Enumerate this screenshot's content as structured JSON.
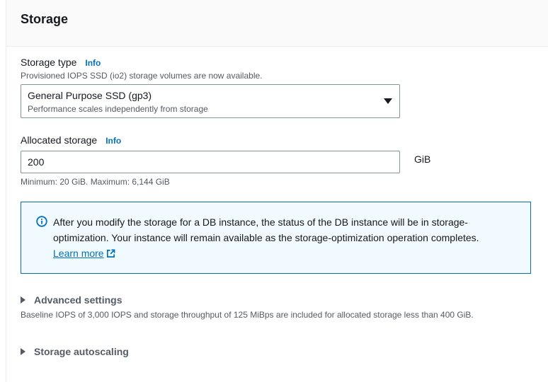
{
  "panel": {
    "title": "Storage"
  },
  "storage_type": {
    "label": "Storage type",
    "info": "Info",
    "description": "Provisioned IOPS SSD (io2) storage volumes are now available.",
    "selected": "General Purpose SSD (gp3)",
    "selected_description": "Performance scales independently from storage"
  },
  "allocated_storage": {
    "label": "Allocated storage",
    "info": "Info",
    "value": "200",
    "unit": "GiB",
    "constraint": "Minimum: 20 GiB. Maximum: 6,144 GiB"
  },
  "alert": {
    "text": "After you modify the storage for a DB instance, the status of the DB instance will be in storage-optimization. Your instance will remain available as the storage-optimization operation completes.",
    "link": "Learn more"
  },
  "advanced": {
    "label": "Advanced settings",
    "description": "Baseline IOPS of 3,000 IOPS and storage throughput of 125 MiBps are included for allocated storage less than 400 GiB."
  },
  "autoscaling": {
    "label": "Storage autoscaling"
  },
  "colors": {
    "link": "#0073bb",
    "alert_border": "#0073bb",
    "alert_bg": "#f1faff"
  }
}
